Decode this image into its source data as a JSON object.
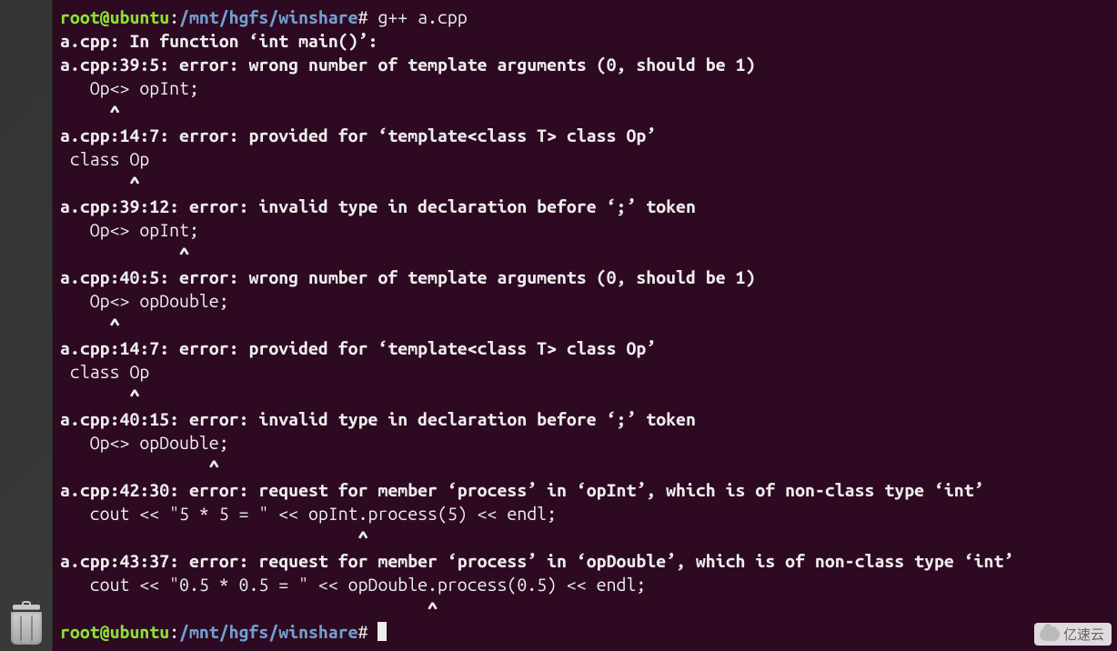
{
  "prompt": {
    "userhost": "root@ubuntu",
    "colon": ":",
    "path": "/mnt/hgfs/winshare",
    "hash": "#"
  },
  "command": "g++ a.cpp",
  "lines": [
    "a.cpp: In function ‘int main()’:",
    "a.cpp:39:5: error: wrong number of template arguments (0, should be 1)",
    "   Op<> opInt;",
    "     ^",
    "a.cpp:14:7: error: provided for ‘template<class T> class Op’",
    " class Op",
    "       ^",
    "a.cpp:39:12: error: invalid type in declaration before ‘;’ token",
    "   Op<> opInt;",
    "            ^",
    "a.cpp:40:5: error: wrong number of template arguments (0, should be 1)",
    "   Op<> opDouble;",
    "     ^",
    "a.cpp:14:7: error: provided for ‘template<class T> class Op’",
    " class Op",
    "       ^",
    "a.cpp:40:15: error: invalid type in declaration before ‘;’ token",
    "   Op<> opDouble;",
    "               ^",
    "a.cpp:42:30: error: request for member ‘process’ in ‘opInt’, which is of non-class type ‘int’",
    "   cout << \"5 * 5 = \" << opInt.process(5) << endl;",
    "                              ^",
    "a.cpp:43:37: error: request for member ‘process’ in ‘opDouble’, which is of non-class type ‘int’",
    "   cout << \"0.5 * 0.5 = \" << opDouble.process(0.5) << endl;",
    "                                     ^"
  ],
  "watermark": "亿速云"
}
